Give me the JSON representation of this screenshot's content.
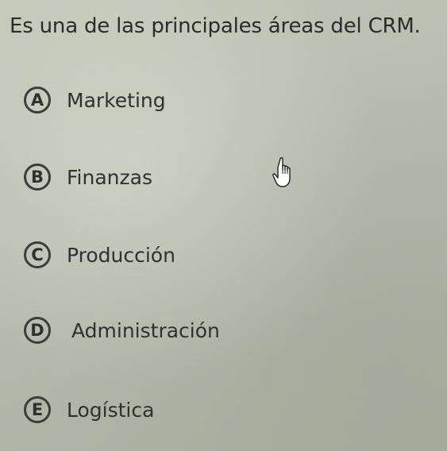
{
  "question": {
    "text": "Es una de las principales áreas del CRM."
  },
  "options": [
    {
      "letter": "A",
      "label": "Marketing"
    },
    {
      "letter": "B",
      "label": "Finanzas"
    },
    {
      "letter": "C",
      "label": "Producción"
    },
    {
      "letter": "D",
      "label": "Administración"
    },
    {
      "letter": "E",
      "label": "Logística"
    }
  ],
  "cursor": {
    "icon": "hand-pointer-icon"
  }
}
